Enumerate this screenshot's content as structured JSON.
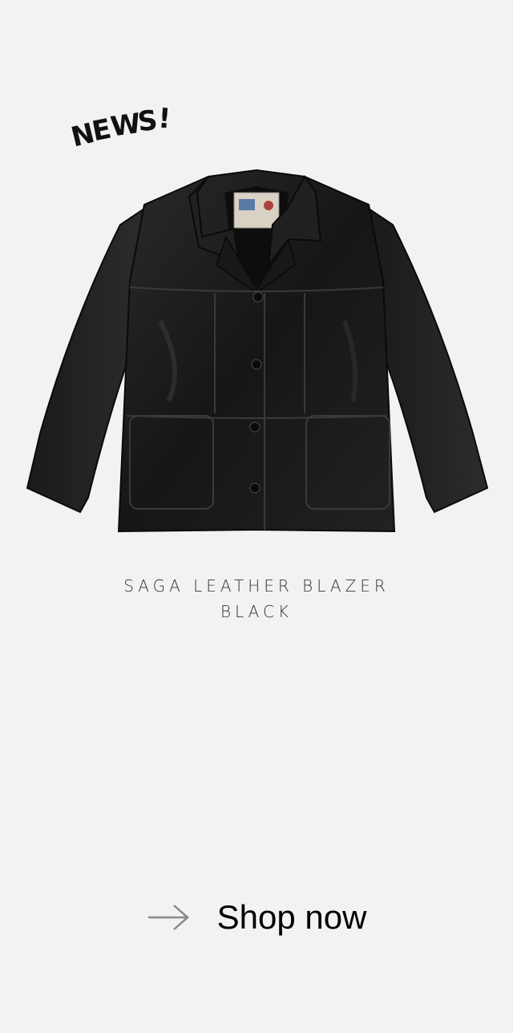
{
  "badge": {
    "letters": [
      "N",
      "E",
      "W",
      "S",
      "!"
    ]
  },
  "product": {
    "name": "SAGA LEATHER BLAZER",
    "color": "BLACK",
    "image_icon": "leather-jacket-image"
  },
  "cta": {
    "label": "Shop now",
    "icon": "arrow-right-icon"
  },
  "colors": {
    "background": "#f2f2f2",
    "jacket": "#1b1b1b",
    "text": "#333333"
  }
}
